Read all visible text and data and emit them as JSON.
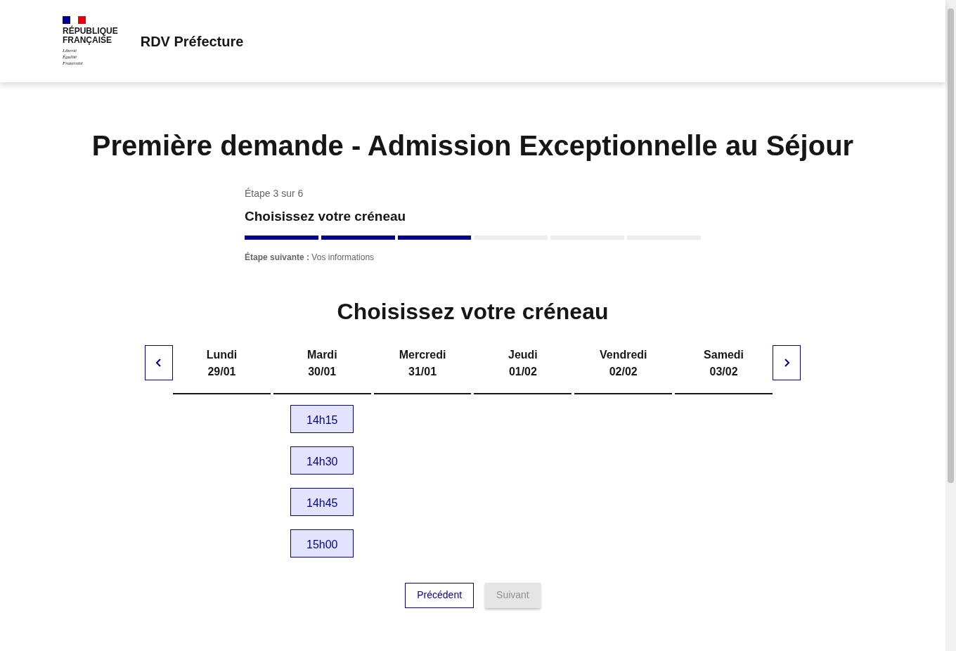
{
  "header": {
    "logo_lines": [
      "RÉPUBLIQUE",
      "FRANÇAISE"
    ],
    "motto": [
      "Liberté",
      "Égalité",
      "Fraternité"
    ],
    "service_name": "RDV Préfecture"
  },
  "page_title": "Première demande - Admission Exceptionnelle au Séjour",
  "stepper": {
    "step_label": "Étape 3 sur 6",
    "step_title": "Choisissez votre créneau",
    "segments": [
      {
        "filled": true
      },
      {
        "filled": true
      },
      {
        "filled": true
      },
      {
        "filled": false
      },
      {
        "filled": false
      },
      {
        "filled": false
      }
    ],
    "next_step": "**Étape suivante :** Vos informations"
  },
  "section_title": "Choisissez votre créneau",
  "days": [
    {
      "day": "Lundi",
      "date": "29/01"
    },
    {
      "day": "Mardi",
      "date": "30/01",
      "slots": [
        {
          "time": "14h15"
        },
        {
          "time": "14h30"
        },
        {
          "time": "14h45"
        },
        {
          "time": "15h00"
        }
      ]
    },
    {
      "day": "Mercredi",
      "date": "31/01"
    },
    {
      "day": "Jeudi",
      "date": "01/02"
    },
    {
      "day": "Vendredi",
      "date": "02/02"
    },
    {
      "day": "Samedi",
      "date": "03/02"
    }
  ],
  "buttons": [
    {
      "label": "Précédent",
      "disabled": false
    },
    {
      "label": "Suivant",
      "disabled": true
    }
  ]
}
